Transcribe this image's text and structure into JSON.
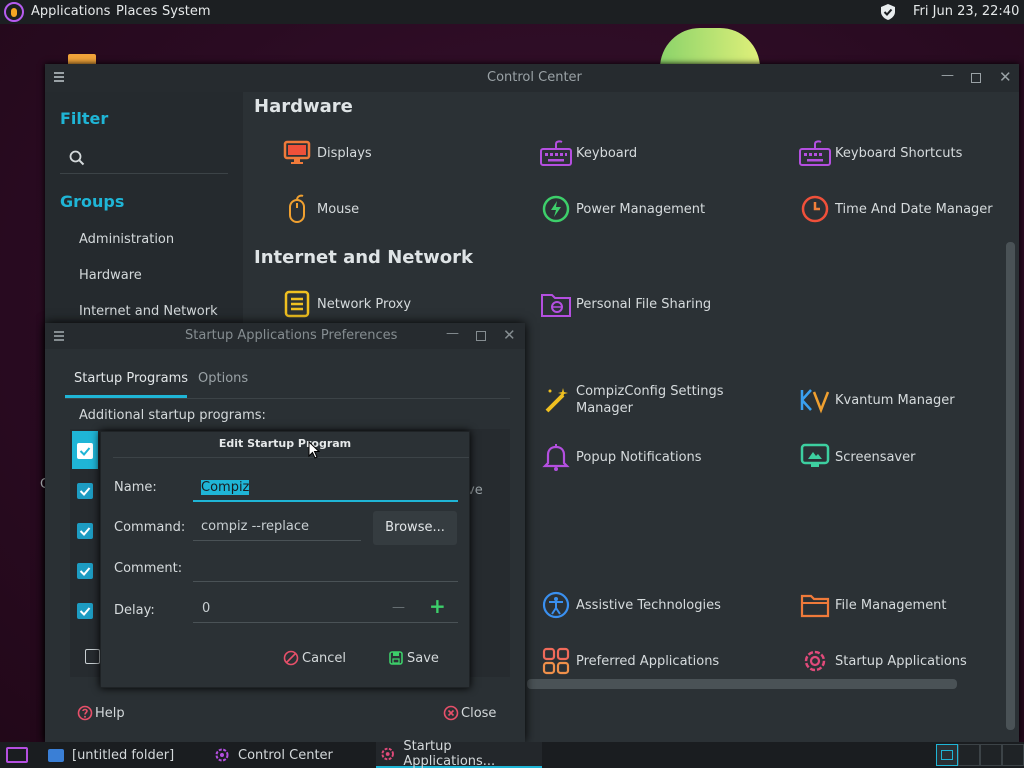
{
  "top_panel": {
    "menus": [
      "Applications",
      "Places",
      "System"
    ],
    "clock": "Fri Jun 23, 22:40"
  },
  "control_center": {
    "title": "Control Center",
    "sidebar": {
      "filter_label": "Filter",
      "search_placeholder": "",
      "groups_label": "Groups",
      "groups": [
        "Administration",
        "Hardware",
        "Internet and Network"
      ]
    },
    "categories": [
      {
        "name": "Hardware",
        "items": [
          "Displays",
          "Keyboard",
          "Keyboard Shortcuts",
          "Mouse",
          "Power Management",
          "Time And Date Manager"
        ]
      },
      {
        "name": "Internet and Network",
        "items": [
          "Network Proxy",
          "Personal File Sharing"
        ]
      },
      {
        "name": "",
        "items": [
          "CompizConfig Settings Manager",
          "Kvantum Manager",
          "Popup Notifications",
          "Screensaver",
          "Assistive Technologies",
          "File Management",
          "Preferred Applications",
          "Startup Applications"
        ]
      }
    ],
    "partial_letter": "C"
  },
  "startup_window": {
    "title": "Startup Applications Preferences",
    "tabs": [
      "Startup Programs",
      "Options"
    ],
    "additional_label": "Additional startup programs:",
    "partial_text": "ve",
    "help_label": "Help",
    "close_label": "Close"
  },
  "edit_dialog": {
    "title": "Edit Startup Program",
    "name_label": "Name:",
    "name_value": "Compiz",
    "command_label": "Command:",
    "command_value": "compiz --replace",
    "browse_label": "Browse...",
    "comment_label": "Comment:",
    "comment_value": "",
    "delay_label": "Delay:",
    "delay_value": "0",
    "minus": "—",
    "plus": "+",
    "cancel_label": "Cancel",
    "save_label": "Save"
  },
  "taskbar": {
    "items": [
      "[untitled folder]",
      "Control Center",
      "Startup Applications..."
    ]
  },
  "colors": {
    "accent": "#1fb5d6",
    "panel_bg": "#1c1f22",
    "window_bg": "#2a3034"
  }
}
